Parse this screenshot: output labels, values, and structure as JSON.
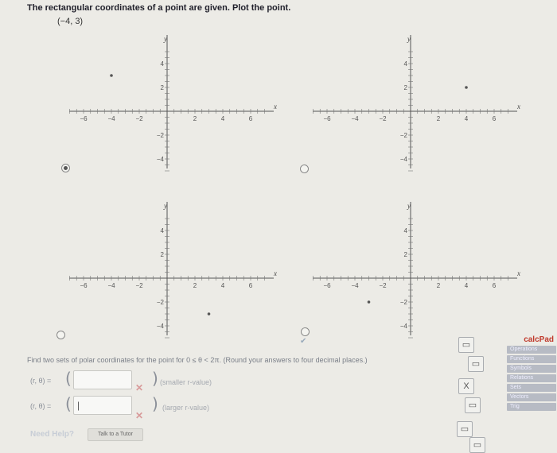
{
  "question": {
    "text": "The rectangular coordinates of a point are given. Plot the point.",
    "point": "(−4, 3)"
  },
  "plots": [
    {
      "id": "a",
      "point": [
        -4,
        3
      ]
    },
    {
      "id": "b",
      "point": [
        4,
        2
      ]
    },
    {
      "id": "c",
      "point": [
        3,
        -3
      ]
    },
    {
      "id": "d",
      "point": [
        -3,
        -2
      ]
    }
  ],
  "axis": {
    "x_label": "x",
    "y_label": "y",
    "x_ticks": [
      {
        "v": -6,
        "t": "−6"
      },
      {
        "v": -4,
        "t": "−4"
      },
      {
        "v": -2,
        "t": "−2"
      },
      {
        "v": 2,
        "t": "2"
      },
      {
        "v": 4,
        "t": "4"
      },
      {
        "v": 6,
        "t": "6"
      }
    ],
    "y_ticks": [
      {
        "v": 4,
        "t": "4"
      },
      {
        "v": 2,
        "t": "2"
      },
      {
        "v": -2,
        "t": "−2"
      },
      {
        "v": -4,
        "t": "−4"
      }
    ],
    "xlim": [
      -7,
      7
    ],
    "ylim": [
      -5,
      5
    ]
  },
  "polar": {
    "instruction": "Find two sets of polar coordinates for the point for 0 ≤ θ < 2π. (Round your answers to four decimal places.)",
    "eq_label": "(r, θ) =",
    "row1": {
      "value": "",
      "hint": "(smaller r-value)"
    },
    "row2": {
      "value": "|",
      "hint": "(larger r-value)"
    }
  },
  "need_help": "Need Help?",
  "tutor_button": "Talk to a Tutor",
  "keypad": {
    "x_key": "X"
  },
  "calcpad": {
    "title": "calcPad",
    "buttons": [
      "Operations",
      "Functions",
      "Symbols",
      "Relations",
      "Sets",
      "Vectors",
      "Trig"
    ]
  }
}
